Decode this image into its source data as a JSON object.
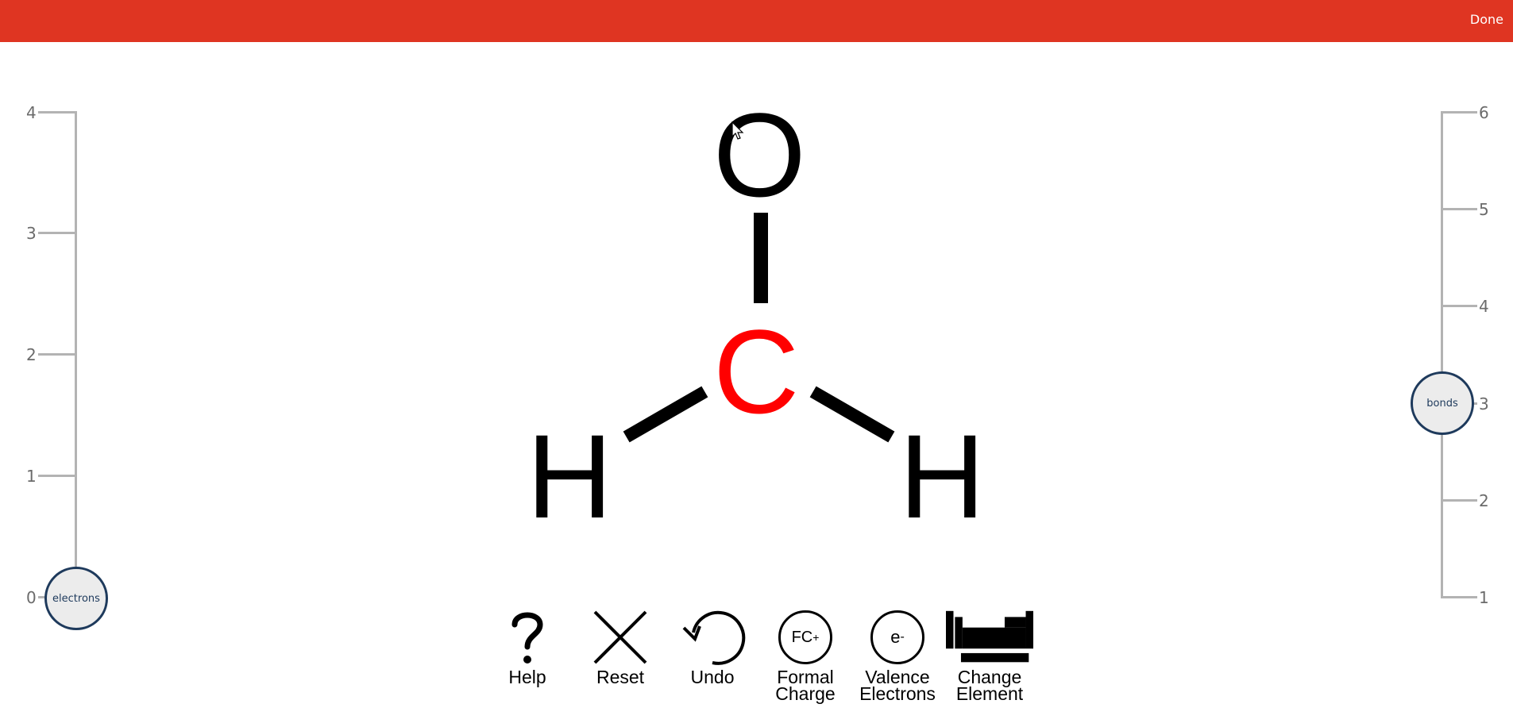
{
  "header": {
    "done_label": "Done",
    "bar_color": "#df3522"
  },
  "electron_slider": {
    "knob_label": "electrons",
    "ticks": [
      "4",
      "3",
      "2",
      "1",
      "0"
    ],
    "value": 0
  },
  "bond_slider": {
    "knob_label": "bonds",
    "ticks": [
      "6",
      "5",
      "4",
      "3",
      "2",
      "1"
    ],
    "value": 3
  },
  "molecule": {
    "atoms": [
      {
        "symbol": "O",
        "color": "#000000"
      },
      {
        "symbol": "C",
        "color": "#ff0000",
        "selected": true
      },
      {
        "symbol": "H",
        "color": "#000000"
      },
      {
        "symbol": "H",
        "color": "#000000"
      }
    ]
  },
  "toolbar": {
    "help": {
      "label": "Help",
      "icon": "question-icon"
    },
    "reset": {
      "label": "Reset",
      "icon": "close-x-icon"
    },
    "undo": {
      "label": "Undo",
      "icon": "undo-arrow-icon"
    },
    "formal_charge": {
      "label": "Formal\nCharge",
      "icon_text": "FC",
      "icon_sup": "+"
    },
    "valence_electrons": {
      "label": "Valence\nElectrons",
      "icon_text": "e",
      "icon_sup": "-"
    },
    "change_element": {
      "label": "Change\nElement",
      "icon": "periodic-table-icon"
    }
  }
}
